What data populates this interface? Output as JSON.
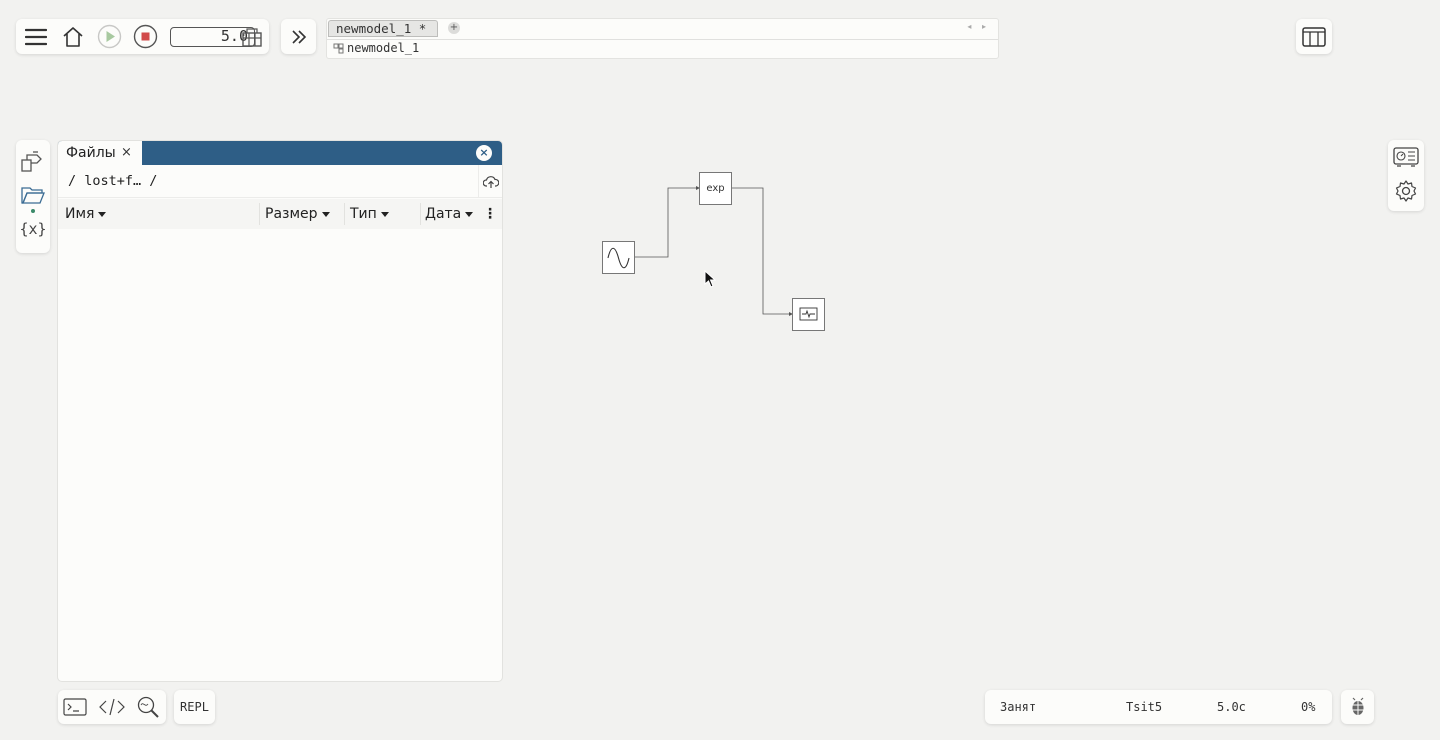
{
  "toolbar": {
    "menu_icon": "hamburger-icon",
    "home_icon": "home-icon",
    "run_icon": "play-icon",
    "stop_icon": "stop-icon",
    "sim_time": "5.0",
    "library_icon": "library-icon",
    "expand_icon": "double-chevron-right-icon",
    "colors": {
      "stop": "#d14a4a",
      "run_disabled": "#a8c9a0"
    }
  },
  "tabs": {
    "active_tab_label": "newmodel_1 *",
    "add_tab_label": "+",
    "scroll_arrows": "◂ ▸",
    "breadcrumb_label": "newmodel_1"
  },
  "sidebar": {
    "items": [
      {
        "icon": "blocks-library-icon"
      },
      {
        "icon": "folder-icon"
      },
      {
        "icon": "variables-icon",
        "label": "{x}"
      }
    ]
  },
  "file_panel": {
    "tab_label": "Файлы",
    "tab_close": "×",
    "panel_close": "×",
    "path": "/  lost+f… /",
    "columns": {
      "name": "Имя",
      "size": "Размер",
      "type": "Тип",
      "date": "Дата"
    },
    "more_icon": "⋮",
    "header_color": "#2e5e86"
  },
  "diagram": {
    "blocks": [
      {
        "id": "sine",
        "icon": "sine-wave-icon"
      },
      {
        "id": "exp",
        "label": "exp"
      },
      {
        "id": "scope",
        "icon": "scope-icon"
      }
    ]
  },
  "right_panel": {
    "items": [
      {
        "icon": "dashboard-icon"
      },
      {
        "icon": "settings-icon"
      }
    ]
  },
  "bottom": {
    "tools": [
      {
        "icon": "terminal-icon"
      },
      {
        "icon": "code-icon"
      },
      {
        "icon": "search-zoom-icon"
      }
    ],
    "repl_label": "REPL"
  },
  "status": {
    "state": "Занят",
    "solver": "Tsit5",
    "time": "5.0с",
    "progress": "0%",
    "progress_value": 0
  }
}
